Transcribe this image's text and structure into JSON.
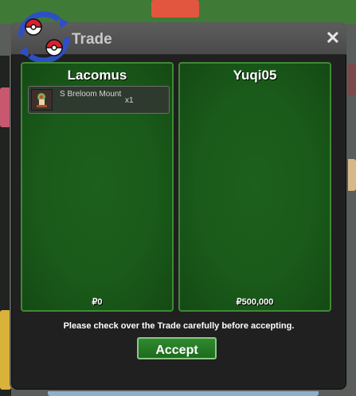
{
  "window": {
    "title": "Trade",
    "close_label": "✕"
  },
  "left_panel": {
    "name": "Lacomus",
    "items": [
      {
        "name": "S Breloom Mount",
        "qty": "x1",
        "icon": "breloom-mount-icon"
      }
    ],
    "money": "₽0"
  },
  "right_panel": {
    "name": "Yuqi05",
    "items": [],
    "money": "₽500,000"
  },
  "notice": "Please check over the Trade carefully before accepting.",
  "accept_label": "Accept",
  "colors": {
    "panel_green": "#1a5a1a",
    "panel_border": "#3f8a36",
    "button_green": "#2f8a2f",
    "window_bg": "#1f201f",
    "logo_blue": "#2e4fc4",
    "logo_red": "#d8222b"
  }
}
